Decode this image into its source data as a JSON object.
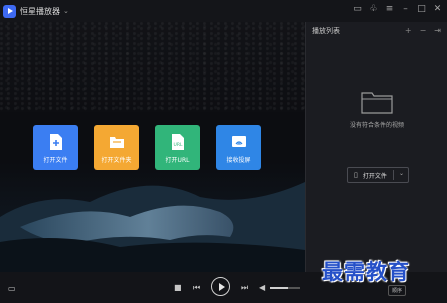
{
  "window": {
    "title": "恒星播放器"
  },
  "buttons": [
    {
      "label": "打开文件",
      "color": "#3b7ef2",
      "icon": "file-plus-icon"
    },
    {
      "label": "打开文件夹",
      "color": "#f4a833",
      "icon": "folder-open-icon"
    },
    {
      "label": "打开URL",
      "color": "#31b57a",
      "icon": "link-icon"
    },
    {
      "label": "接收投屏",
      "color": "#2f86e6",
      "icon": "cast-icon"
    }
  ],
  "playlist": {
    "title": "播放列表",
    "empty_text": "没有符合条件的视频",
    "open_file_label": "打开文件",
    "mode_label": "顺序"
  },
  "volume": {
    "level": 0.6
  },
  "watermark": "最需教育"
}
